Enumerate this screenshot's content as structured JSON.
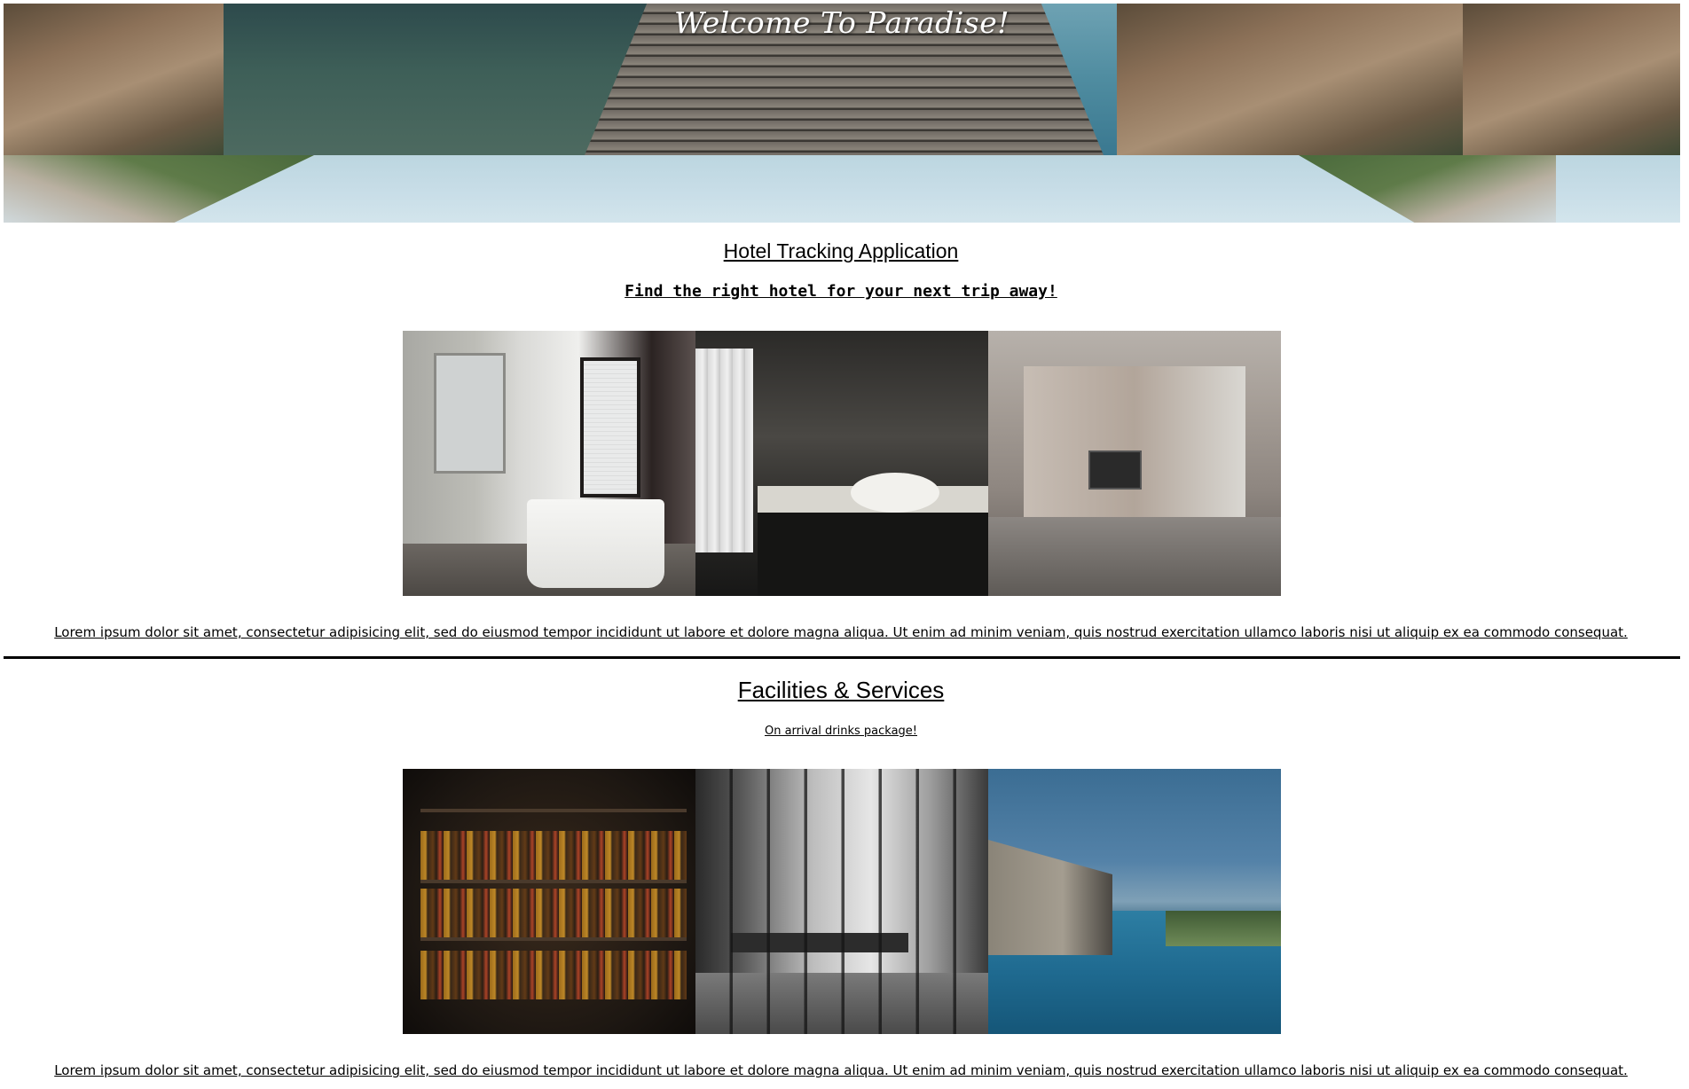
{
  "banner": {
    "title": "Welcome To Paradise!"
  },
  "hotel_section": {
    "title": "Hotel Tracking Application",
    "subtitle": "Find the right hotel for your next trip away!",
    "paragraph": "Lorem ipsum dolor sit amet, consectetur adipisicing elit, sed do eiusmod tempor incididunt ut labore et dolore magna aliqua. Ut enim ad minim veniam, quis nostrud exercitation ullamco laboris nisi ut aliquip ex ea commodo consequat."
  },
  "facilities_section": {
    "title": "Facilities & Services",
    "subtitle": "On arrival drinks package!",
    "paragraph": "Lorem ipsum dolor sit amet, consectetur adipisicing elit, sed do eiusmod tempor incididunt ut labore et dolore magna aliqua. Ut enim ad minim veniam, quis nostrud exercitation ullamco laboris nisi ut aliquip ex ea commodo consequat."
  }
}
